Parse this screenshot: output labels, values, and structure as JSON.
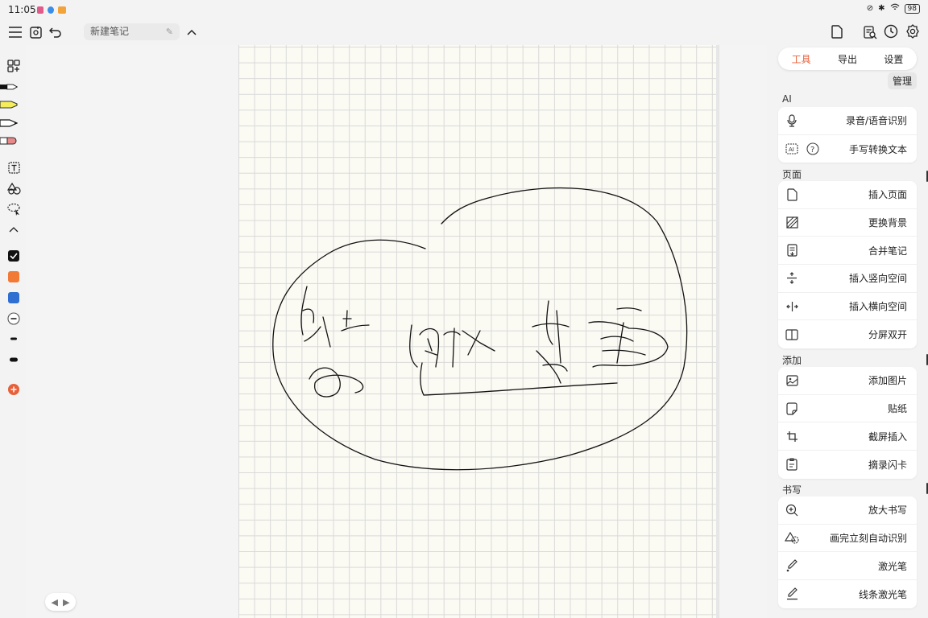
{
  "status": {
    "time": "11:05",
    "battery": "98"
  },
  "colors": {
    "accent": "#e8603a",
    "orange": "#f07a36",
    "blue": "#2f6fd1",
    "add": "#e8603a"
  },
  "toolbar": {
    "note_title": "新建笔记"
  },
  "left_tools": [
    "layout-icon",
    "pen-black-icon",
    "highlighter-yellow-icon",
    "pencil-icon",
    "eraser-icon",
    "text-tool-icon",
    "shapes-icon",
    "lasso-icon",
    "collapse-icon"
  ],
  "panel": {
    "tabs": [
      "工具",
      "导出",
      "设置"
    ],
    "active_tab": "工具",
    "manage_label": "管理",
    "sections": [
      {
        "title": "AI",
        "items": [
          {
            "label": "录音/语音识别",
            "icon": "microphone-icon"
          },
          {
            "label": "手写转换文本",
            "icon": "ai-text-icon"
          }
        ]
      },
      {
        "title": "页面",
        "items": [
          {
            "label": "插入页面",
            "icon": "page-icon"
          },
          {
            "label": "更换背景",
            "icon": "background-icon"
          },
          {
            "label": "合并笔记",
            "icon": "merge-icon"
          },
          {
            "label": "插入竖向空间",
            "icon": "vertical-space-icon"
          },
          {
            "label": "插入横向空间",
            "icon": "horizontal-space-icon"
          },
          {
            "label": "分屏双开",
            "icon": "split-screen-icon"
          }
        ]
      },
      {
        "title": "添加",
        "items": [
          {
            "label": "添加图片",
            "icon": "image-icon"
          },
          {
            "label": "贴纸",
            "icon": "sticker-icon"
          },
          {
            "label": "截屏插入",
            "icon": "crop-icon"
          },
          {
            "label": "摘录闪卡",
            "icon": "flashcard-icon"
          }
        ]
      },
      {
        "title": "书写",
        "items": [
          {
            "label": "放大书写",
            "icon": "zoom-write-icon"
          },
          {
            "label": "画完立刻自动识别",
            "icon": "shape-recognize-icon"
          },
          {
            "label": "激光笔",
            "icon": "laser-pen-icon"
          },
          {
            "label": "线条激光笔",
            "icon": "line-laser-icon"
          }
        ]
      }
    ]
  }
}
